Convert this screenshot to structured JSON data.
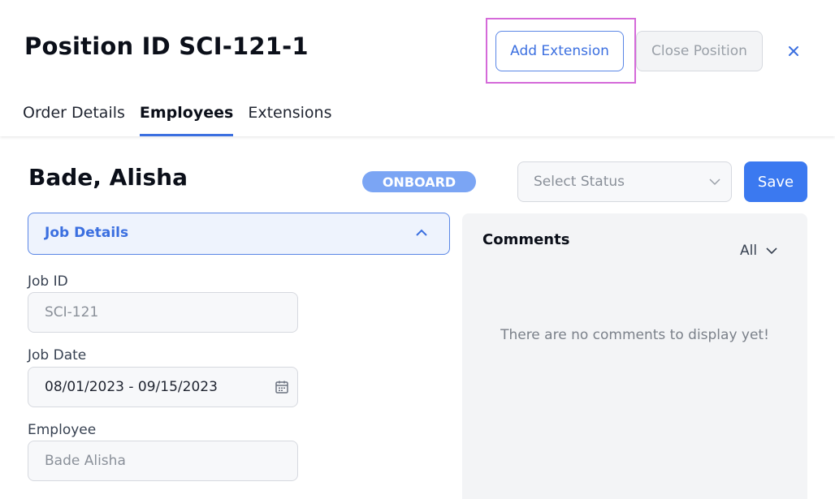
{
  "header": {
    "title": "Position ID SCI-121-1",
    "add_extension_label": "Add Extension",
    "close_position_label": "Close Position",
    "close_icon": "close-icon"
  },
  "tabs": [
    {
      "label": "Order Details",
      "active": false
    },
    {
      "label": "Employees",
      "active": true
    },
    {
      "label": "Extensions",
      "active": false
    }
  ],
  "employee": {
    "name": "Bade, Alisha",
    "status_badge": "ONBOARD",
    "status_select_placeholder": "Select Status",
    "save_label": "Save"
  },
  "job_details": {
    "section_label": "Job Details",
    "job_id_label": "Job ID",
    "job_id_value": "SCI-121",
    "job_date_label": "Job Date",
    "job_date_value": "08/01/2023 - 09/15/2023",
    "employee_label": "Employee",
    "employee_value": "Bade Alisha"
  },
  "comments": {
    "title": "Comments",
    "filter_value": "All",
    "empty_text": "There are no comments to display yet!"
  },
  "colors": {
    "accent": "#3b6fe0",
    "badge": "#7ba5f4",
    "highlight": "#d56ad9"
  }
}
